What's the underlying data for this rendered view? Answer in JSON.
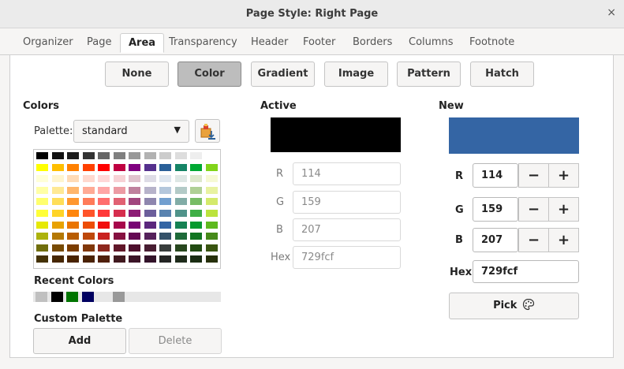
{
  "window": {
    "title": "Page Style: Right Page",
    "close_glyph": "×"
  },
  "tabs": [
    {
      "label": "Organizer"
    },
    {
      "label": "Page"
    },
    {
      "label": "Area"
    },
    {
      "label": "Transparency"
    },
    {
      "label": "Header"
    },
    {
      "label": "Footer"
    },
    {
      "label": "Borders"
    },
    {
      "label": "Columns"
    },
    {
      "label": "Footnote"
    }
  ],
  "active_tab": "Area",
  "fill_types": [
    {
      "label": "None"
    },
    {
      "label": "Color"
    },
    {
      "label": "Gradient"
    },
    {
      "label": "Image"
    },
    {
      "label": "Pattern"
    },
    {
      "label": "Hatch"
    }
  ],
  "active_fill": "Color",
  "colors": {
    "heading": "Colors",
    "palette_label": "Palette:",
    "palette_value": "standard",
    "add_palette_icon": "add-color-to-palette-icon",
    "palette_grid": [
      [
        "#000000",
        "#111111",
        "#1c1c1c",
        "#333333",
        "#666666",
        "#808080",
        "#999999",
        "#b2b2b2",
        "#cccccc",
        "#dddddd",
        "#eeeeee",
        "#ffffff"
      ],
      [
        "#ffff00",
        "#ffbf00",
        "#ff8000",
        "#ff4000",
        "#ff0000",
        "#bf0041",
        "#800080",
        "#55308d",
        "#2a6099",
        "#158466",
        "#00a933",
        "#81d41a"
      ],
      [
        "#ffffd7",
        "#fff5ce",
        "#ffdbb6",
        "#ffd8ce",
        "#ffd7d7",
        "#f7d1d5",
        "#e0c2cd",
        "#dedce6",
        "#dee6ef",
        "#dee7e5",
        "#dde8cb",
        "#f6f9d4"
      ],
      [
        "#ffffa6",
        "#ffe994",
        "#ffb66c",
        "#ffaa95",
        "#ffa6a6",
        "#ec9ba4",
        "#bf819e",
        "#b7b3ca",
        "#b4c7dc",
        "#b3cac7",
        "#afd095",
        "#e8f2a1"
      ],
      [
        "#ffff6d",
        "#ffde59",
        "#ff972f",
        "#ff7b59",
        "#ff6d6d",
        "#e16173",
        "#a1467e",
        "#8e86ae",
        "#729fcf",
        "#81aca6",
        "#77bc65",
        "#d4ea6b"
      ],
      [
        "#ffff38",
        "#ffd428",
        "#ff860d",
        "#ff5429",
        "#ff3838",
        "#d62e4e",
        "#8d1d75",
        "#6b5e9b",
        "#5983b0",
        "#50938a",
        "#3faf46",
        "#bbe33d"
      ],
      [
        "#e6e905",
        "#e8a202",
        "#ea7500",
        "#ed4c05",
        "#f10d0c",
        "#a7074b",
        "#780373",
        "#5b277d",
        "#3465a4",
        "#168253",
        "#069a2e",
        "#5eb91e"
      ],
      [
        "#acb20c",
        "#b47804",
        "#b85c00",
        "#be480a",
        "#c9211e",
        "#861141",
        "#650953",
        "#55215b",
        "#355269",
        "#1e6a39",
        "#127622",
        "#468a1a"
      ],
      [
        "#706e0c",
        "#784b04",
        "#7b3d00",
        "#813709",
        "#8d281e",
        "#611729",
        "#4e102d",
        "#481d32",
        "#383d3c",
        "#28471f",
        "#224b12",
        "#395511"
      ],
      [
        "#443205",
        "#472702",
        "#492300",
        "#4b2204",
        "#50200c",
        "#41191f",
        "#3b1427",
        "#33132a",
        "#242524",
        "#1e2b1b",
        "#1a2d13",
        "#26300b"
      ]
    ],
    "recent_label": "Recent Colors",
    "recent": [
      "#c0c0c0",
      "#000000",
      "#007500",
      "#000060",
      "#e7e7e7",
      "#999999"
    ],
    "custom_label": "Custom Palette",
    "add_label": "Add",
    "delete_label": "Delete"
  },
  "active": {
    "heading": "Active",
    "swatch_color": "#000000",
    "r_label": "R",
    "r": "114",
    "g_label": "G",
    "g": "159",
    "b_label": "B",
    "b": "207",
    "hex_label": "Hex",
    "hex": "729fcf"
  },
  "new": {
    "heading": "New",
    "swatch_color": "#3465a4",
    "r_label": "R",
    "r": "114",
    "g_label": "G",
    "g": "159",
    "b_label": "B",
    "b": "207",
    "hex_label": "Hex",
    "hex": "729fcf",
    "minus": "−",
    "plus": "+",
    "pick_label": "Pick",
    "pick_icon": "color-picker-palette-icon"
  }
}
